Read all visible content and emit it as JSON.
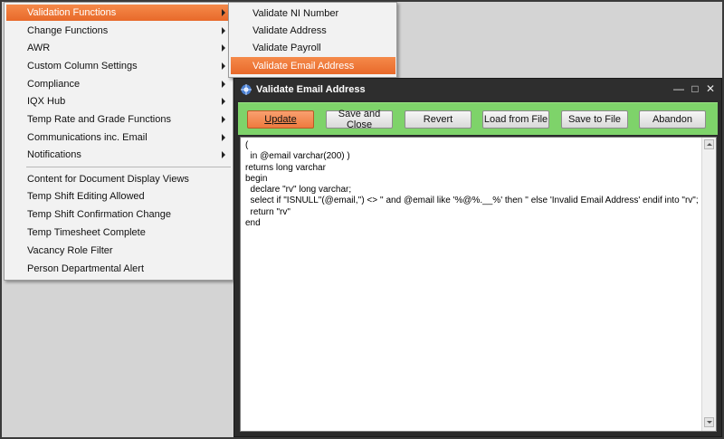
{
  "menu": {
    "items": [
      {
        "label": "Validation Functions",
        "submenu": true,
        "highlighted": true
      },
      {
        "label": "Change Functions",
        "submenu": true
      },
      {
        "label": "AWR",
        "submenu": true
      },
      {
        "label": "Custom Column Settings",
        "submenu": true
      },
      {
        "label": "Compliance",
        "submenu": true
      },
      {
        "label": "IQX Hub",
        "submenu": true
      },
      {
        "label": "Temp Rate and Grade Functions",
        "submenu": true
      },
      {
        "label": "Communications inc. Email",
        "submenu": true
      },
      {
        "label": "Notifications",
        "submenu": true
      },
      {
        "label": "Content for Document Display Views",
        "submenu": false
      },
      {
        "label": "Temp Shift Editing Allowed",
        "submenu": false
      },
      {
        "label": "Temp Shift Confirmation Change",
        "submenu": false
      },
      {
        "label": "Temp Timesheet Complete",
        "submenu": false
      },
      {
        "label": "Vacancy Role Filter",
        "submenu": false
      },
      {
        "label": "Person Departmental Alert",
        "submenu": false
      }
    ]
  },
  "submenu": {
    "items": [
      {
        "label": "Validate NI Number"
      },
      {
        "label": "Validate Address"
      },
      {
        "label": "Validate Payroll"
      },
      {
        "label": "Validate Email Address",
        "highlighted": true
      }
    ]
  },
  "dialog": {
    "title": "Validate Email Address",
    "buttons": {
      "update": "Update",
      "save_close": "Save and Close",
      "revert": "Revert",
      "load": "Load from File",
      "save_file": "Save to File",
      "abandon": "Abandon"
    },
    "code": "(\n  in @email varchar(200) )\nreturns long varchar\nbegin\n  declare \"rv\" long varchar;\n  select if \"ISNULL\"(@email,'') <> '' and @email like '%@%.__%' then '' else 'Invalid Email Address' endif into \"rv\";\n  return \"rv\"\nend"
  },
  "colors": {
    "highlight": "#ee7a3e",
    "toolbar": "#7ed36a",
    "titlebar": "#2e2e2e"
  }
}
